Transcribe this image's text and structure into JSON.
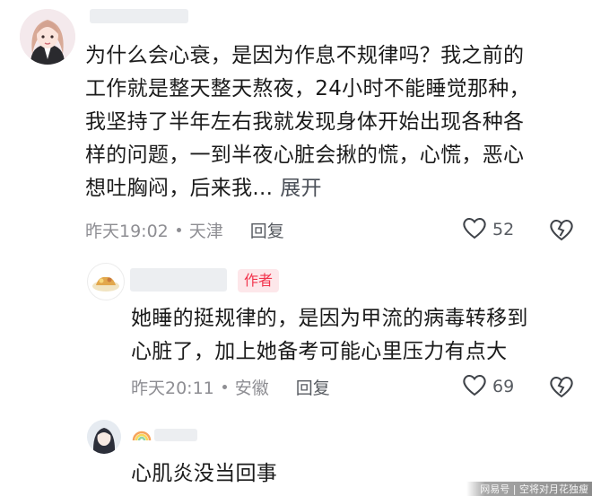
{
  "comments": [
    {
      "text": "为什么会心衰，是因为作息不规律吗？我之前的工作就是整天整天熬夜，24小时不能睡觉那种，我坚持了半年左右我就发现身体开始出现各种各样的问题，一到半夜心脏会揪的慌，心慌，恶心想吐胸闷，后来我...",
      "lines": [
        "为什么会心衰，是因为作息不规律吗？我之前的",
        "工作就是整天整天熬夜，24小时不能睡觉那种，",
        "我坚持了半年左右我就发现身体开始出现各种各",
        "样的问题，一到半夜心脏会揪的慌，心慌，恶心",
        "想吐胸闷，后来我..."
      ],
      "expand_label": "展开",
      "time": "昨天19:02",
      "location": "天津",
      "reply_label": "回复",
      "likes": "52",
      "replies": [
        {
          "badge": "作者",
          "lines": [
            "她睡的挺规律的，是因为甲流的病毒转移到",
            "心脏了，加上她备考可能心里压力有点大"
          ],
          "time": "昨天20:11",
          "location": "安徽",
          "reply_label": "回复",
          "likes": "69"
        },
        {
          "lines": [
            "心肌炎没当回事"
          ]
        }
      ]
    }
  ],
  "watermark": "网易号 | 空将对月花独瘦",
  "colors": {
    "accent": "#f2344d",
    "badge_bg": "#fde7ea",
    "meta": "#8e8e93"
  },
  "icons": [
    "heart-icon",
    "broken-heart-icon",
    "location-dot-icon"
  ]
}
